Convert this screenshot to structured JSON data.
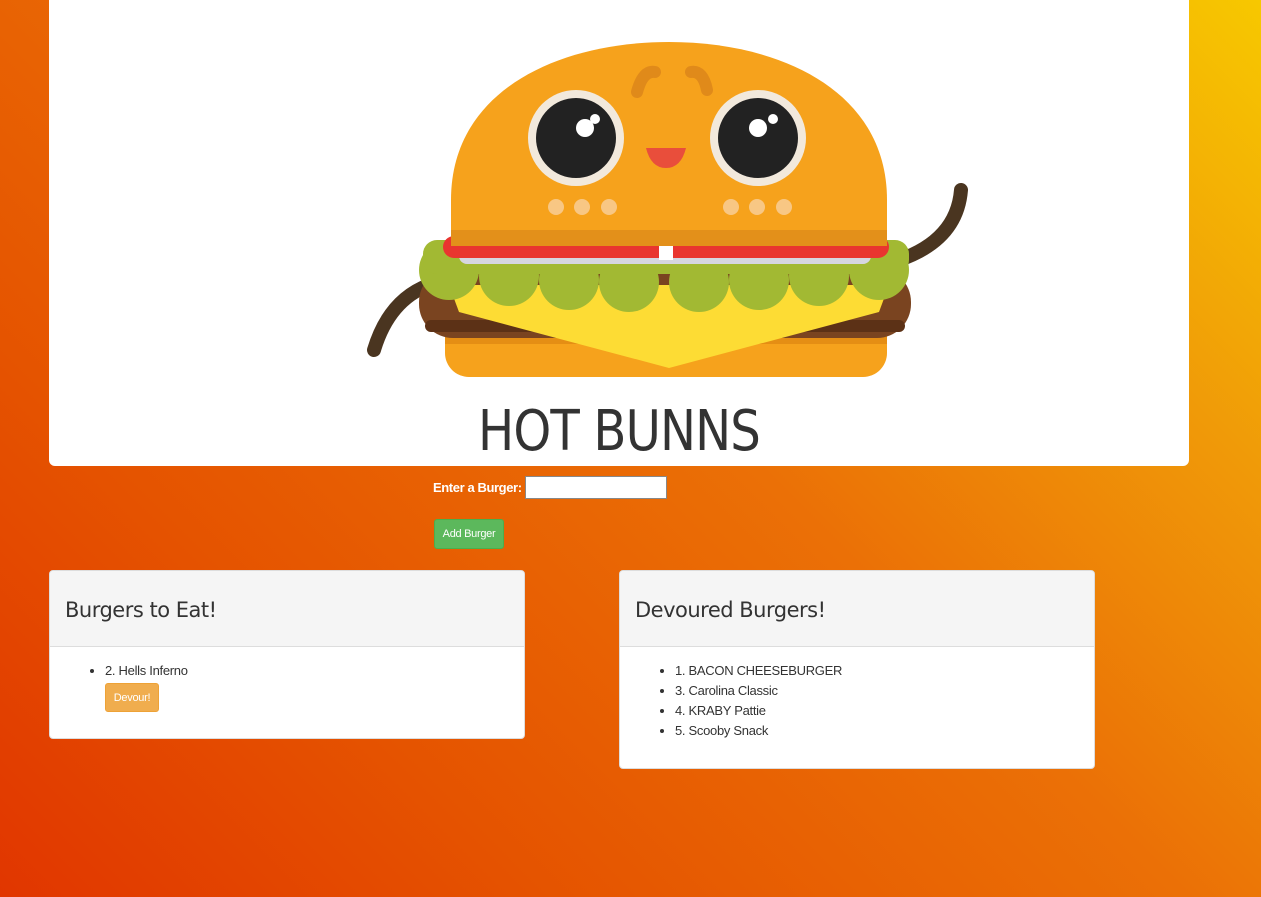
{
  "header": {
    "title": "HOT BUNNS"
  },
  "form": {
    "label": "Enter a Burger:",
    "input_value": "",
    "submit_label": "Add Burger"
  },
  "to_eat": {
    "heading": "Burgers to Eat!",
    "items": [
      {
        "label": "2. Hells Inferno",
        "action_label": "Devour!"
      }
    ]
  },
  "devoured": {
    "heading": "Devoured Burgers!",
    "items": [
      {
        "label": "1. BACON CHEESEBURGER"
      },
      {
        "label": "3. Carolina Classic"
      },
      {
        "label": "4. KRABY Pattie"
      },
      {
        "label": "5. Scooby Snack"
      }
    ]
  },
  "colors": {
    "add_button": "#5cb85c",
    "devour_button": "#f0ad4e",
    "background_top_right": "#f7c800",
    "background_bottom_left": "#e13600"
  },
  "icons": {
    "mascot": "cartoon-burger-mascot"
  }
}
